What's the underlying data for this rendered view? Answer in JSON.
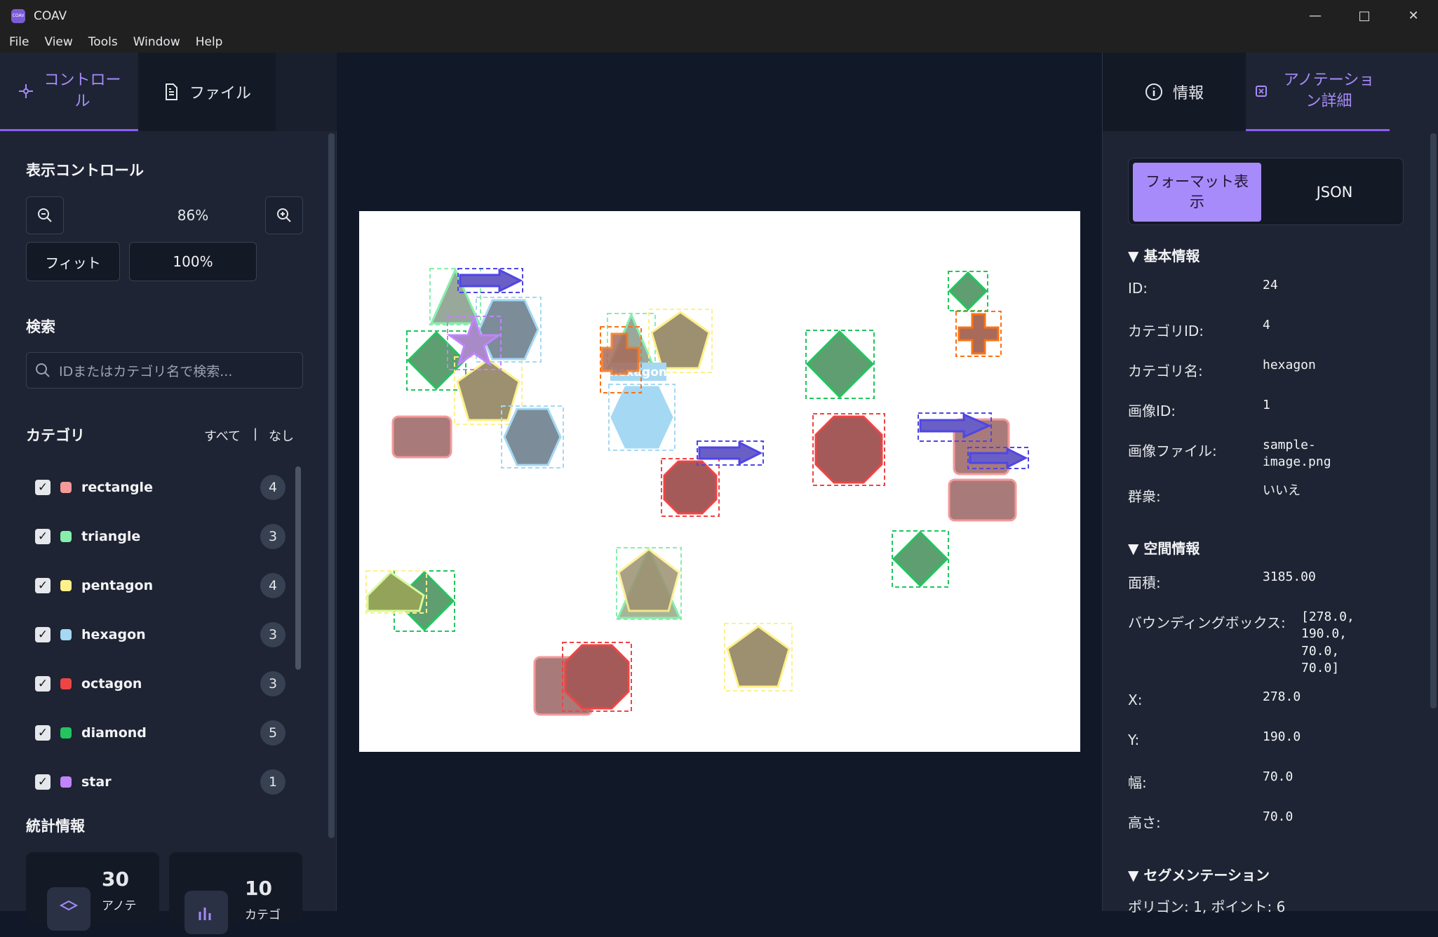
{
  "window": {
    "title": "COAV",
    "logo_text": "COAV"
  },
  "menu": [
    "File",
    "View",
    "Tools",
    "Window",
    "Help"
  ],
  "left_panel": {
    "tabs": [
      {
        "label": "コントロール",
        "active": true
      },
      {
        "label": "ファイル",
        "active": false
      }
    ],
    "display_controls": {
      "title": "表示コントロール",
      "zoom_level": "86%",
      "fit_label": "フィット",
      "reset_label": "100%"
    },
    "search": {
      "title": "検索",
      "placeholder": "IDまたはカテゴリ名で検索..."
    },
    "categories": {
      "title": "カテゴリ",
      "all_label": "すべて",
      "separator": "|",
      "none_label": "なし",
      "items": [
        {
          "name": "rectangle",
          "color": "#f49a9a",
          "count": "4",
          "checked": true
        },
        {
          "name": "triangle",
          "color": "#86efac",
          "count": "3",
          "checked": true
        },
        {
          "name": "pentagon",
          "color": "#fef08a",
          "count": "4",
          "checked": true
        },
        {
          "name": "hexagon",
          "color": "#a5d8f3",
          "count": "3",
          "checked": true
        },
        {
          "name": "octagon",
          "color": "#ef4444",
          "count": "3",
          "checked": true
        },
        {
          "name": "diamond",
          "color": "#22c55e",
          "count": "5",
          "checked": true
        },
        {
          "name": "star",
          "color": "#c084fc",
          "count": "1",
          "checked": true
        }
      ]
    },
    "stats": {
      "title": "統計情報",
      "annotations": {
        "value": "30",
        "label": "アノテ"
      },
      "categories": {
        "value": "10",
        "label": "カテゴ"
      }
    }
  },
  "canvas": {
    "image_label": "hexagon"
  },
  "right_panel": {
    "tabs": [
      {
        "label": "情報",
        "active": false
      },
      {
        "label": "アノテーション詳細",
        "active": true
      }
    ],
    "view_toggle": {
      "format_label": "フォーマット表示",
      "json_label": "JSON",
      "selected": "format"
    },
    "basic": {
      "title": "▼ 基本情報",
      "rows": [
        {
          "label": "ID:",
          "value": "24"
        },
        {
          "label": "カテゴリID:",
          "value": "4"
        },
        {
          "label": "カテゴリ名:",
          "value": "hexagon"
        },
        {
          "label": "画像ID:",
          "value": "1"
        },
        {
          "label": "画像ファイル:",
          "value": "sample-\nimage.png"
        },
        {
          "label": "群衆:",
          "value": "いいえ"
        }
      ]
    },
    "spatial": {
      "title": "▼ 空間情報",
      "rows": [
        {
          "label": "面積:",
          "value": "3185.00"
        },
        {
          "label": "バウンディングボックス:",
          "value": "[278.0,\n190.0,\n70.0,\n70.0]"
        },
        {
          "label": "X:",
          "value": "278.0"
        },
        {
          "label": "Y:",
          "value": "190.0"
        },
        {
          "label": "幅:",
          "value": "70.0"
        },
        {
          "label": "高さ:",
          "value": "70.0"
        }
      ]
    },
    "segmentation": {
      "title": "▼ セグメンテーション",
      "summary": "ポリゴン: 1, ポイント: 6"
    }
  }
}
